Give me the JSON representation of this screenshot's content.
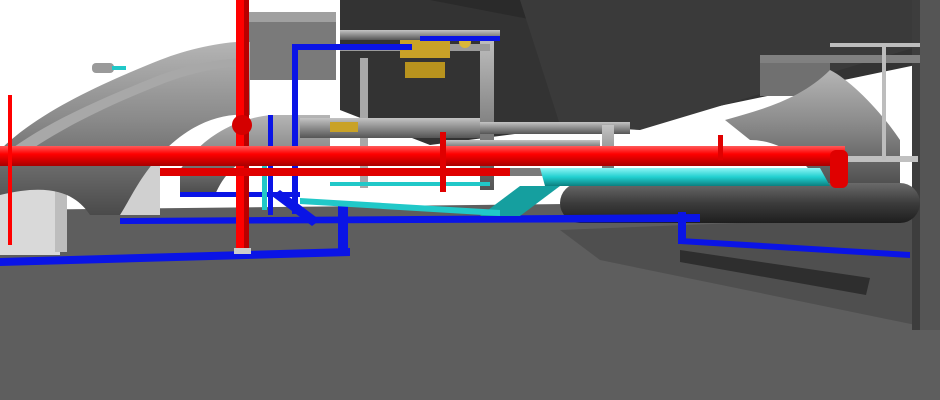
{
  "scene": {
    "type": "bim-3d-mep-view",
    "colors": {
      "sky": "#ffffff",
      "floor": "#5e5e5e",
      "ceiling_slab": "#333333",
      "duct_gray": "#8a8a8a",
      "fire_pipe_red": "#ff0000",
      "water_pipe_blue": "#0a14e6",
      "chilled_pipe_cyan": "#21c8c8",
      "valve_gold": "#c9a227",
      "wall_light": "#d9d9d9"
    }
  }
}
